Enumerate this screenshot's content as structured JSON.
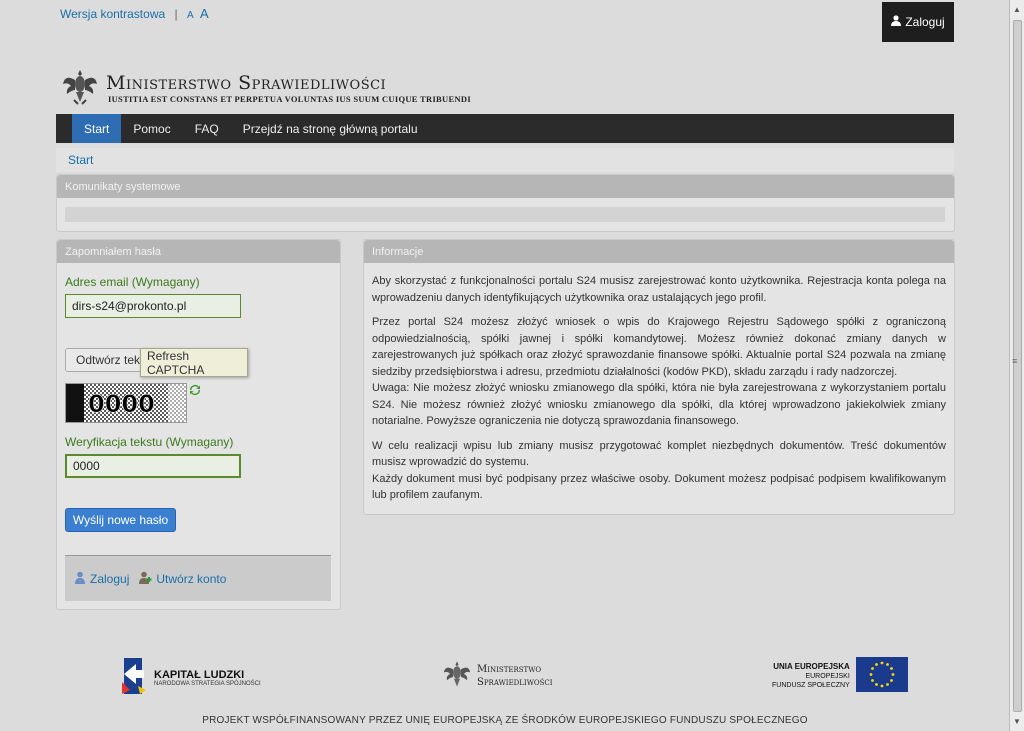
{
  "top": {
    "contrast_label": "Wersja kontrastowa",
    "separator": "|",
    "font_small": "A",
    "font_large": "A",
    "login_label": "Zaloguj"
  },
  "logo": {
    "title": "Ministerstwo Sprawiedliwości",
    "motto": "IUSTITIA EST CONSTANS ET PERPETUA VOLUNTAS IUS SUUM CUIQUE TRIBUENDI"
  },
  "nav": {
    "items": [
      {
        "label": "Start"
      },
      {
        "label": "Pomoc"
      },
      {
        "label": "FAQ"
      },
      {
        "label": "Przejdź na stronę główną portalu"
      }
    ]
  },
  "breadcrumb": {
    "label": "Start"
  },
  "system_panel": {
    "title": "Komunikaty systemowe"
  },
  "forgot_panel": {
    "title": "Zapomniałem hasła",
    "email_label": "Adres email (Wymagany)",
    "email_value": "dirs-s24@prokonto.pl",
    "read_text_button": "Odtwórz tekst",
    "tooltip": "Refresh CAPTCHA",
    "captcha_text": "0000",
    "verify_label": "Weryfikacja tekstu (Wymagany)",
    "verify_value": "0000",
    "submit_label": "Wyślij nowe hasło",
    "login_link": "Zaloguj",
    "register_link": "Utwórz konto"
  },
  "info_panel": {
    "title": "Informacje",
    "paragraphs": [
      "Aby skorzystać z funkcjonalności portalu S24 musisz zarejestrować konto użytkownika. Rejestracja konta polega na wprowadzeniu danych identyfikujących użytkownika oraz ustalających jego profil.",
      "Przez portal S24 możesz złożyć wniosek o wpis do Krajowego Rejestru Sądowego spółki z ograniczoną odpowiedzialnością, spółki jawnej i spółki komandytowej. Możesz również dokonać zmiany danych w zarejestrowanych już spółkach oraz złożyć sprawozdanie finansowe spółki. Aktualnie portal S24 pozwala na zmianę siedziby przedsiębiorstwa i adresu, przedmiotu działalności (kodów PKD), składu zarządu i rady nadzorczej.",
      "Uwaga: Nie możesz złożyć wniosku zmianowego dla spółki, która nie była zarejestrowana z wykorzystaniem portalu S24. Nie możesz również złożyć wniosku zmianowego dla spółki, dla której wprowadzono jakiekolwiek zmiany notarialne. Powyższe ograniczenia nie dotyczą sprawozdania finansowego.",
      "W celu realizacji wpisu lub zmiany musisz przygotować komplet niezbędnych dokumentów. Treść dokumentów musisz wprowadzić do systemu.",
      "Każdy dokument musi być podpisany przez właściwe osoby. Dokument możesz podpisać podpisem kwalifikowanym lub profilem zaufanym."
    ]
  },
  "footer": {
    "kl_title": "KAPITAŁ LUDZKI",
    "kl_subtitle": "NARODOWA STRATEGIA SPÓJNOŚCI",
    "ms_line1": "Ministerstwo",
    "ms_line2": "Sprawiedliwości",
    "eu_line1": "UNIA EUROPEJSKA",
    "eu_line2": "EUROPEJSKI",
    "eu_line3": "FUNDUSZ SPOŁECZNY",
    "project_text": "PROJEKT WSPÓŁFINANSOWANY PRZEZ UNIĘ EUROPEJSKĄ ZE ŚRODKÓW EUROPEJSKIEGO FUNDUSZU SPOŁECZNEGO"
  },
  "colors": {
    "nav_bg": "#2b2b2b",
    "nav_active": "#2e6db4",
    "link": "#1a6fa8",
    "label_green": "#3a7a1a",
    "button_blue": "#3a7fd0"
  }
}
